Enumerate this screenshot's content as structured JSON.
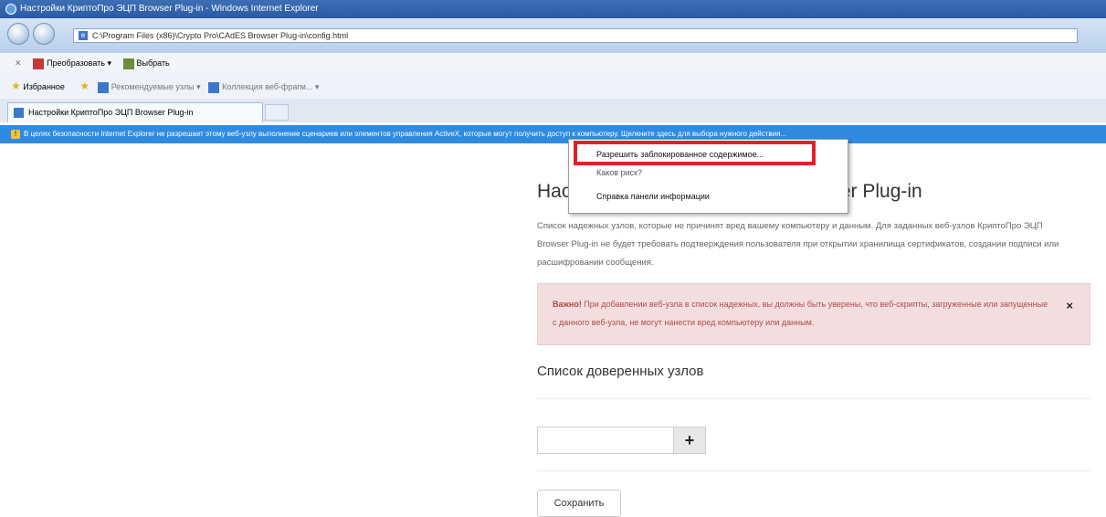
{
  "window": {
    "title": "Настройки КриптоПро ЭЦП Browser Plug-in - Windows Internet Explorer"
  },
  "address_bar": {
    "url": "C:\\Program Files (x86)\\Crypto Pro\\CAdES Browser Plug-in\\config.html"
  },
  "command_bar": {
    "convert_label": "Преобразовать",
    "select_label": "Выбрать"
  },
  "favorites_bar": {
    "favorites_label": "Избранное",
    "suggested_sites": "Рекомендуемые узлы",
    "web_slices": "Коллекция веб-фрагм..."
  },
  "tab": {
    "label": "Настройки КриптоПро ЭЦП Browser Plug-in"
  },
  "infobar": {
    "text": "В целях безопасности Internet Explorer не разрешает этому веб-узлу выполнение сценариев или элементов управления ActiveX, которые могут получить доступ к компьютеру. Щелкните здесь для выбора нужного действия..."
  },
  "context_menu": {
    "items": [
      "Разрешить заблокированное содержимое...",
      "Каков риск?",
      "Справка панели информации"
    ]
  },
  "page": {
    "heading_visible_start": "Нас",
    "heading_visible_end": "ser Plug-in",
    "description": "Список надежных узлов, которые не причинят вред вашему компьютеру и данным. Для заданных веб-узлов КриптоПро ЭЦП Browser Plug-in не будет требовать подтверждения пользователя при открытии хранилища сертификатов, создании подписи или расшифровании сообщения.",
    "alert_bold": "Важно!",
    "alert_text": " При добавлении веб-узла в список надежных, вы должны быть уверены, что веб-скрипты, загруженные или запущенные с данного веб-узла, не могут нанести вред компьютеру или данным.",
    "alert_close": "×",
    "trusted_heading": "Список доверенных узлов",
    "add_button": "+",
    "save_button": "Сохранить"
  },
  "colors": {
    "infobar": "#2f8ae0",
    "highlight": "#e0212b",
    "alert_bg": "#f2dede",
    "alert_text": "#b24a4a"
  }
}
